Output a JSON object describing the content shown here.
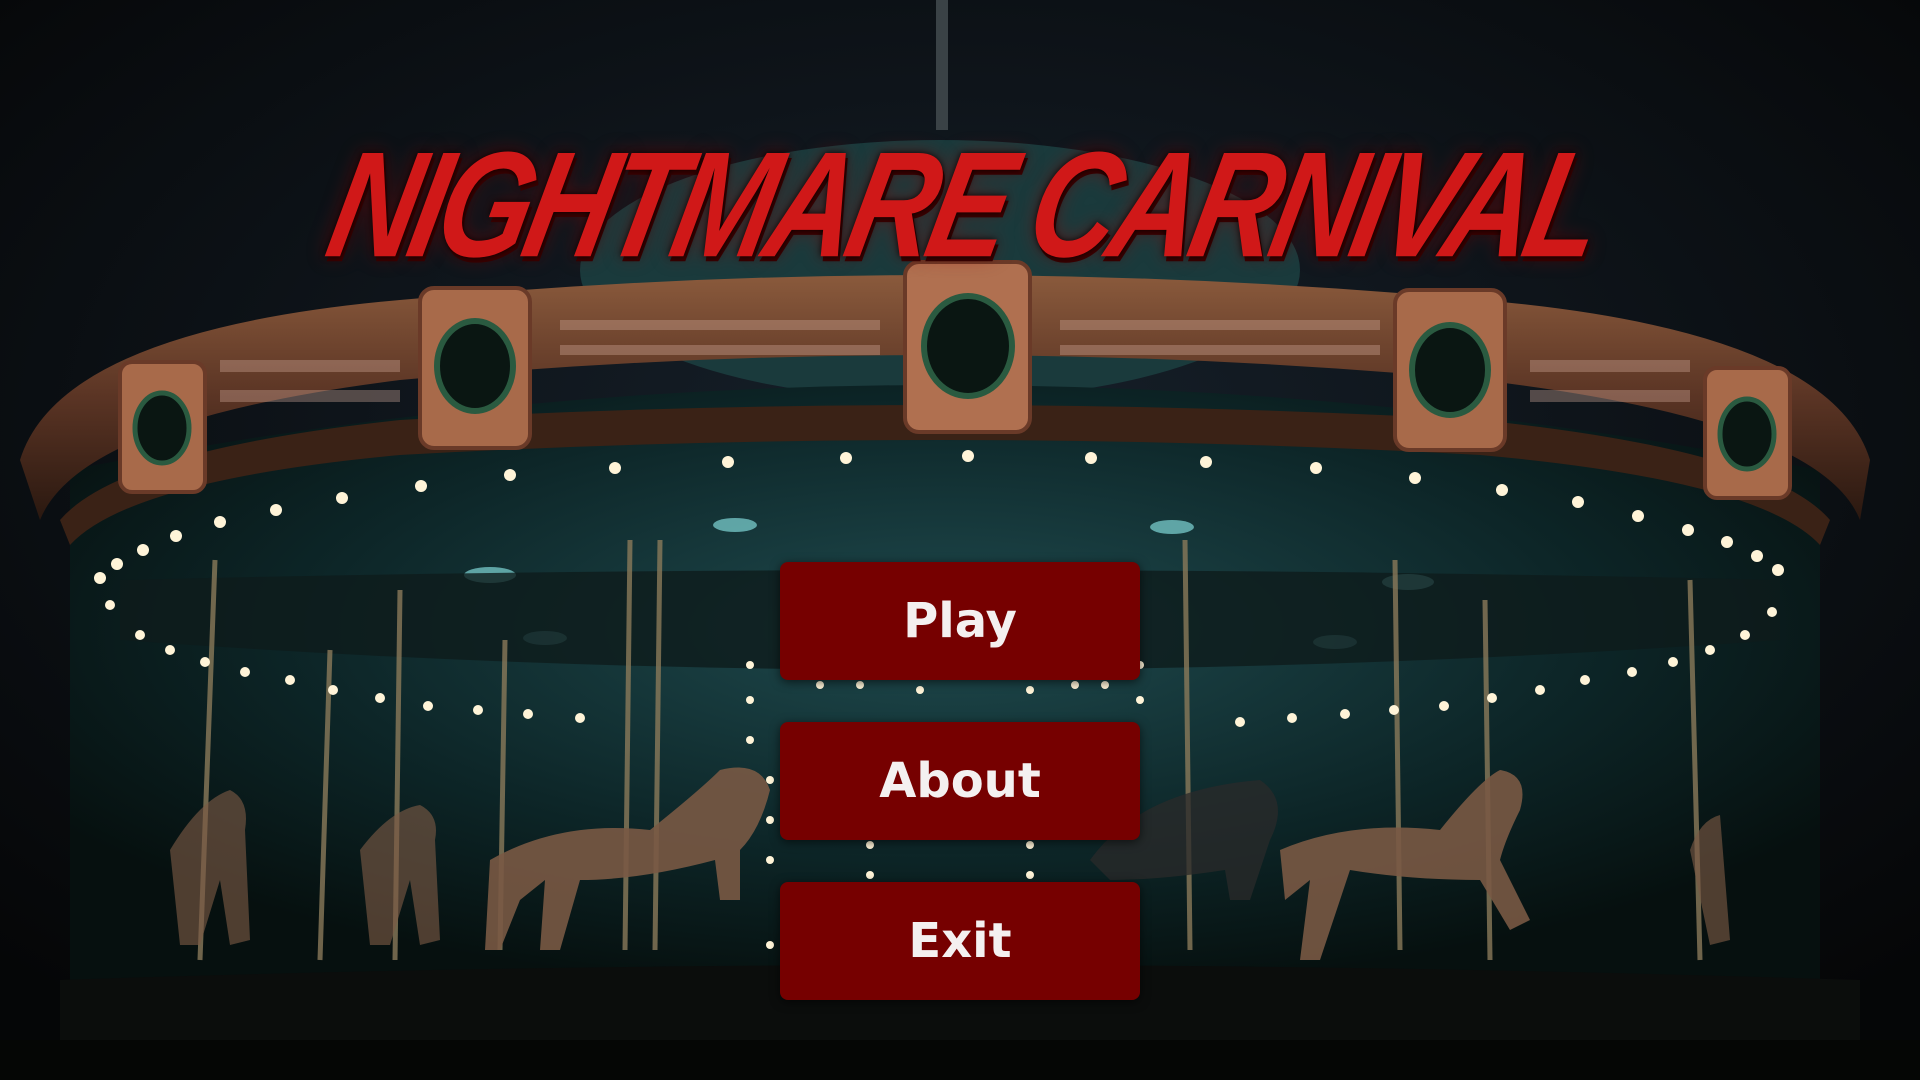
{
  "game": {
    "title": "NIGHTMARE CARNIVAL"
  },
  "menu": {
    "items": [
      {
        "label": "Play"
      },
      {
        "label": "About"
      },
      {
        "label": "Exit"
      }
    ]
  },
  "colors": {
    "title": "#d01818",
    "button_bg": "#760000",
    "button_text": "#f4f0f0",
    "background": "#07090b"
  }
}
